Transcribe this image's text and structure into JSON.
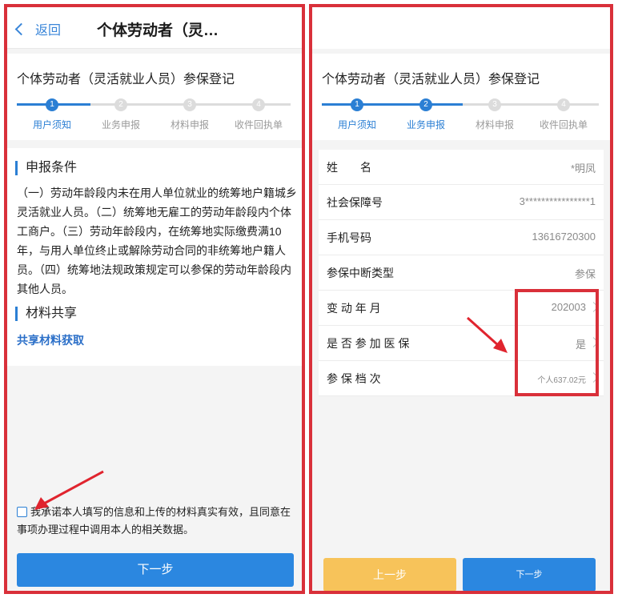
{
  "left": {
    "back_label": "返回",
    "title": "个体劳动者（灵…",
    "reg_title": "个体劳动者（灵活就业人员）参保登记",
    "steps": [
      {
        "num": "1",
        "label": "用户须知"
      },
      {
        "num": "2",
        "label": "业务申报"
      },
      {
        "num": "3",
        "label": "材料申报"
      },
      {
        "num": "4",
        "label": "收件回执单"
      }
    ],
    "conditions_heading": "申报条件",
    "conditions_text": "（一）劳动年龄段内未在用人单位就业的统筹地户籍城乡灵活就业人员。（二）统筹地无雇工的劳动年龄段内个体工商户。（三）劳动年龄段内，在统筹地实际缴费满10年，与用人单位终止或解除劳动合同的非统筹地户籍人员。（四）统筹地法规政策规定可以参保的劳动年龄段内其他人员。",
    "share_heading": "材料共享",
    "share_link": "共享材料获取",
    "agree_text": "我承诺本人填写的信息和上传的材料真实有效，且同意在事项办理过程中调用本人的相关数据。",
    "next_button": "下一步"
  },
  "right": {
    "reg_title": "个体劳动者（灵活就业人员）参保登记",
    "steps": [
      {
        "num": "1",
        "label": "用户须知"
      },
      {
        "num": "2",
        "label": "业务申报"
      },
      {
        "num": "3",
        "label": "材料申报"
      },
      {
        "num": "4",
        "label": "收件回执单"
      }
    ],
    "form": [
      {
        "label": "姓　　名",
        "value": "*明凤"
      },
      {
        "label": "社会保障号",
        "value": "3****************1"
      },
      {
        "label": "手机号码",
        "value": "13616720300"
      },
      {
        "label": "参保中断类型",
        "value": "参保"
      },
      {
        "label": "变 动 年 月",
        "value": "202003"
      },
      {
        "label": "是 否 参 加 医 保",
        "value": "是"
      },
      {
        "label": "参 保 档 次",
        "value": "个人637.02元"
      }
    ],
    "prev_button": "上一步",
    "next_button": "下一步"
  },
  "colors": {
    "accent": "#2b87e0",
    "warning": "#f7c35a",
    "highlight": "#d9303a"
  },
  "icons": [
    "back-chevron-icon",
    "chevron-right-icon",
    "checkbox-icon",
    "annotation-arrow-icon"
  ]
}
